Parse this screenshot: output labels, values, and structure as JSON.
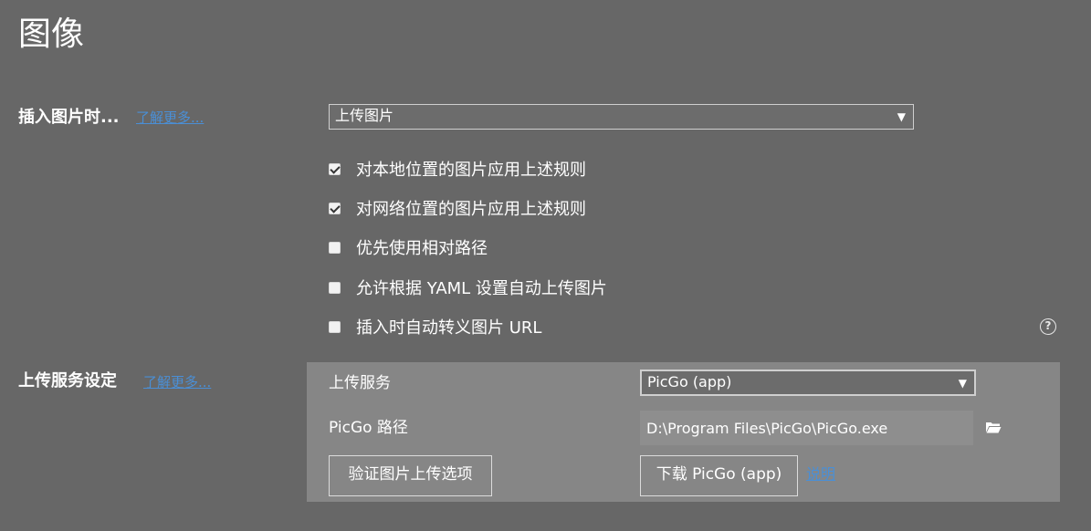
{
  "page": {
    "title": "图像"
  },
  "insert_image": {
    "label": "插入图片时...",
    "learn_more": "了解更多...",
    "action_selected": "上传图片",
    "dropdown_arrow": "▼",
    "options": [
      {
        "label": "对本地位置的图片应用上述规则",
        "checked": true
      },
      {
        "label": "对网络位置的图片应用上述规则",
        "checked": true
      },
      {
        "label": "优先使用相对路径",
        "checked": false
      },
      {
        "label": "允许根据 YAML 设置自动上传图片",
        "checked": false
      },
      {
        "label": "插入时自动转义图片 URL",
        "checked": false
      }
    ],
    "help_glyph": "?"
  },
  "upload_service": {
    "label": "上传服务设定",
    "learn_more": "了解更多...",
    "service_label": "上传服务",
    "service_selected": "PicGo (app)",
    "dropdown_arrow": "▼",
    "path_label": "PicGo 路径",
    "path_value": "D:\\Program Files\\PicGo\\PicGo.exe",
    "verify_button": "验证图片上传选项",
    "download_button": "下载 PicGo (app)",
    "doc_link": "说明"
  },
  "icons": {
    "help": "question-circle-icon",
    "folder": "folder-open-icon",
    "dropdown": "caret-down-icon"
  },
  "colors": {
    "background": "#676767",
    "panel": "#868686",
    "link": "#4a8fd6",
    "text": "#ffffff"
  }
}
